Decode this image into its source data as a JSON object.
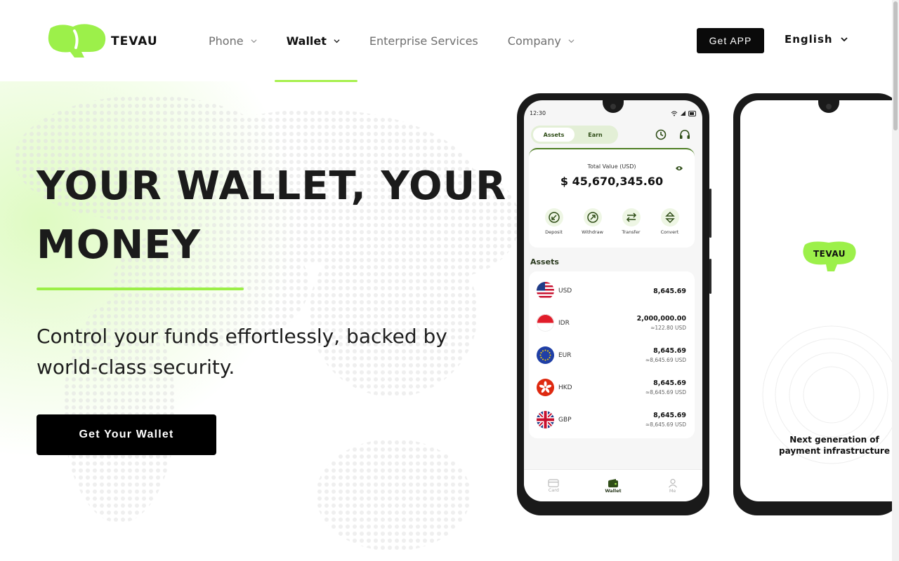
{
  "brand": {
    "name": "TEVAU",
    "accent": "#a6f04c"
  },
  "nav": {
    "items": [
      {
        "label": "Phone",
        "dropdown": true,
        "active": false
      },
      {
        "label": "Wallet",
        "dropdown": true,
        "active": true
      },
      {
        "label": "Enterprise Services",
        "dropdown": false,
        "active": false
      },
      {
        "label": "Company",
        "dropdown": true,
        "active": false
      }
    ],
    "get_app": "Get APP",
    "language": "English"
  },
  "hero": {
    "title_line1": "YOUR WALLET, YOUR",
    "title_line2": "MONEY",
    "subtitle": "Control your funds effortlessly, backed by world-class security.",
    "cta": "Get Your Wallet"
  },
  "phone_app": {
    "time": "12:30",
    "tabs": [
      "Assets",
      "Earn"
    ],
    "total_label": "Total Value (USD)",
    "total_value": "$ 45,670,345.60",
    "actions": [
      "Deposit",
      "Withdraw",
      "Transfer",
      "Convert"
    ],
    "assets_title": "Assets",
    "assets": [
      {
        "code": "USD",
        "amount": "8,645.69",
        "usd": ""
      },
      {
        "code": "IDR",
        "amount": "2,000,000.00",
        "usd": "≈122.80 USD"
      },
      {
        "code": "EUR",
        "amount": "8,645.69",
        "usd": "≈8,645.69 USD"
      },
      {
        "code": "HKD",
        "amount": "8,645.69",
        "usd": "≈8,645.69 USD"
      },
      {
        "code": "GBP",
        "amount": "8,645.69",
        "usd": "≈8,645.69 USD"
      }
    ],
    "bottom_nav": [
      "Card",
      "Wallet",
      "Me"
    ]
  },
  "phone_splash": {
    "logo_text": "TEVAU",
    "tagline_line1": "Next generation of",
    "tagline_line2": "payment infrastructure"
  }
}
